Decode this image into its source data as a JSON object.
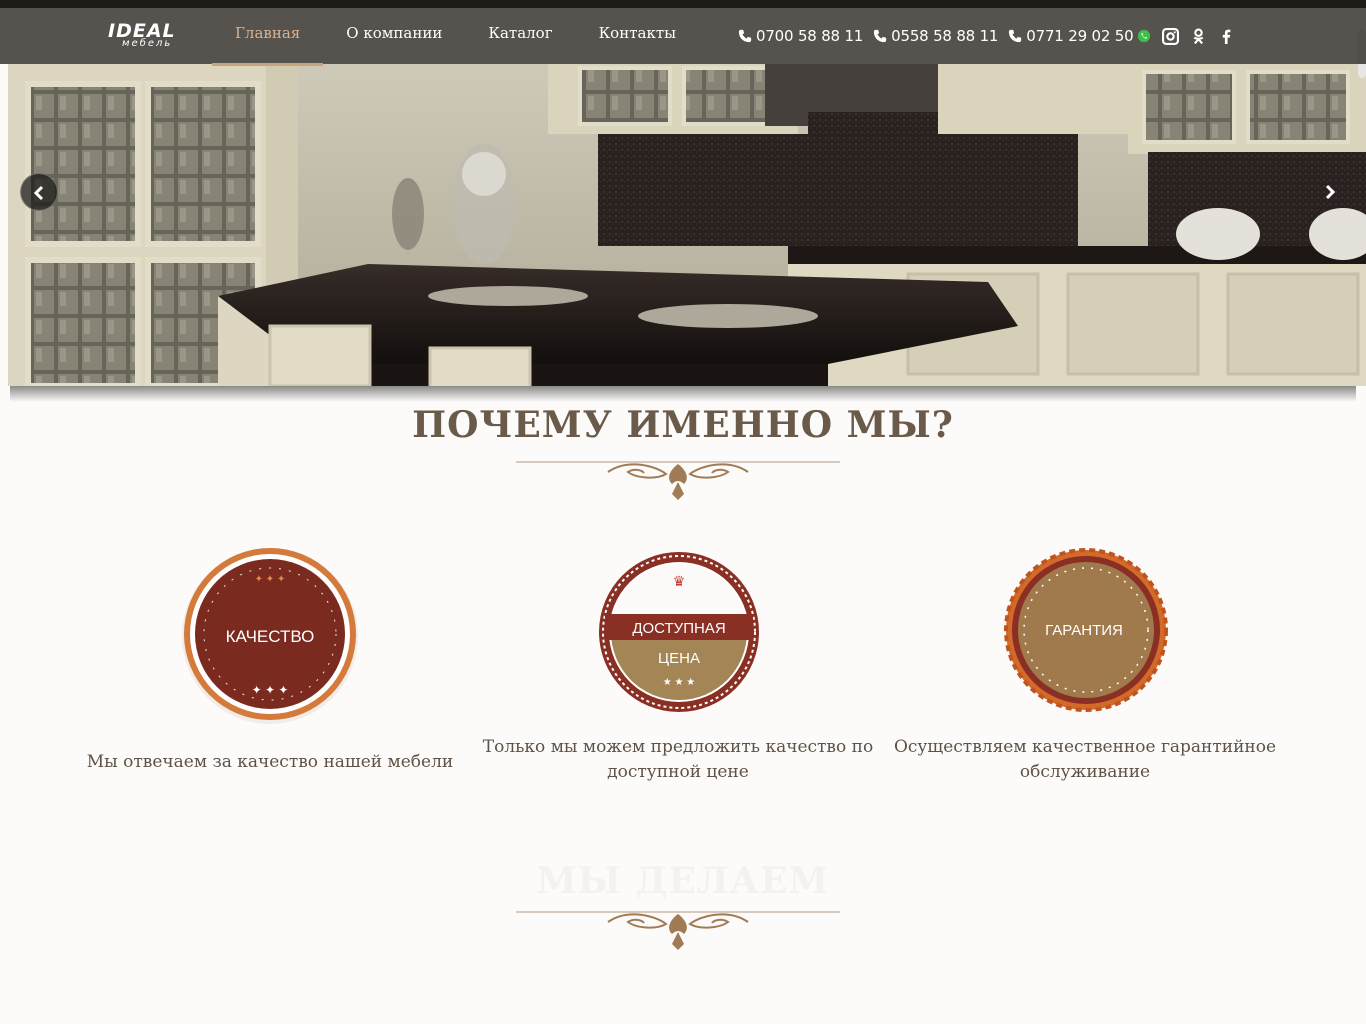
{
  "logo": {
    "main": "IDEAL",
    "sub": "мебель"
  },
  "nav": [
    {
      "label": "Главная",
      "active": true
    },
    {
      "label": "О компании",
      "active": false
    },
    {
      "label": "Каталог",
      "active": false
    },
    {
      "label": "Контакты",
      "active": false
    }
  ],
  "contacts": {
    "phone1": "0700 58 88 11",
    "phone2": "0558 58 88 11",
    "phone3": "0771 29 02 50",
    "icons": [
      "phone-icon",
      "whatsapp-icon",
      "instagram-icon",
      "odnoklassniki-icon",
      "facebook-icon"
    ]
  },
  "hero": {
    "prev_icon": "chevron-left-icon",
    "next_icon": "chevron-right-icon"
  },
  "section": {
    "title": "ПОЧЕМУ ИМЕННО МЫ?"
  },
  "features": [
    {
      "badge": "КАЧЕСТВО",
      "desc": "Мы отвечаем за качество нашей мебели"
    },
    {
      "badge_line1": "ДОСТУПНАЯ",
      "badge_line2": "ЦЕНА",
      "desc": "Только мы можем предложить качество по доступной цене"
    },
    {
      "badge": "ГАРАНТИЯ",
      "desc": "Осуществляем качественное гарантийное обслуживание"
    }
  ],
  "next_section": {
    "title": "МЫ ДЕЛАЕМ"
  },
  "colors": {
    "accent": "#c9a27e",
    "badge_red": "#7a2a1e",
    "badge_orange": "#d47a3a",
    "badge_brown": "#9a7446",
    "text": "#5e5246"
  }
}
